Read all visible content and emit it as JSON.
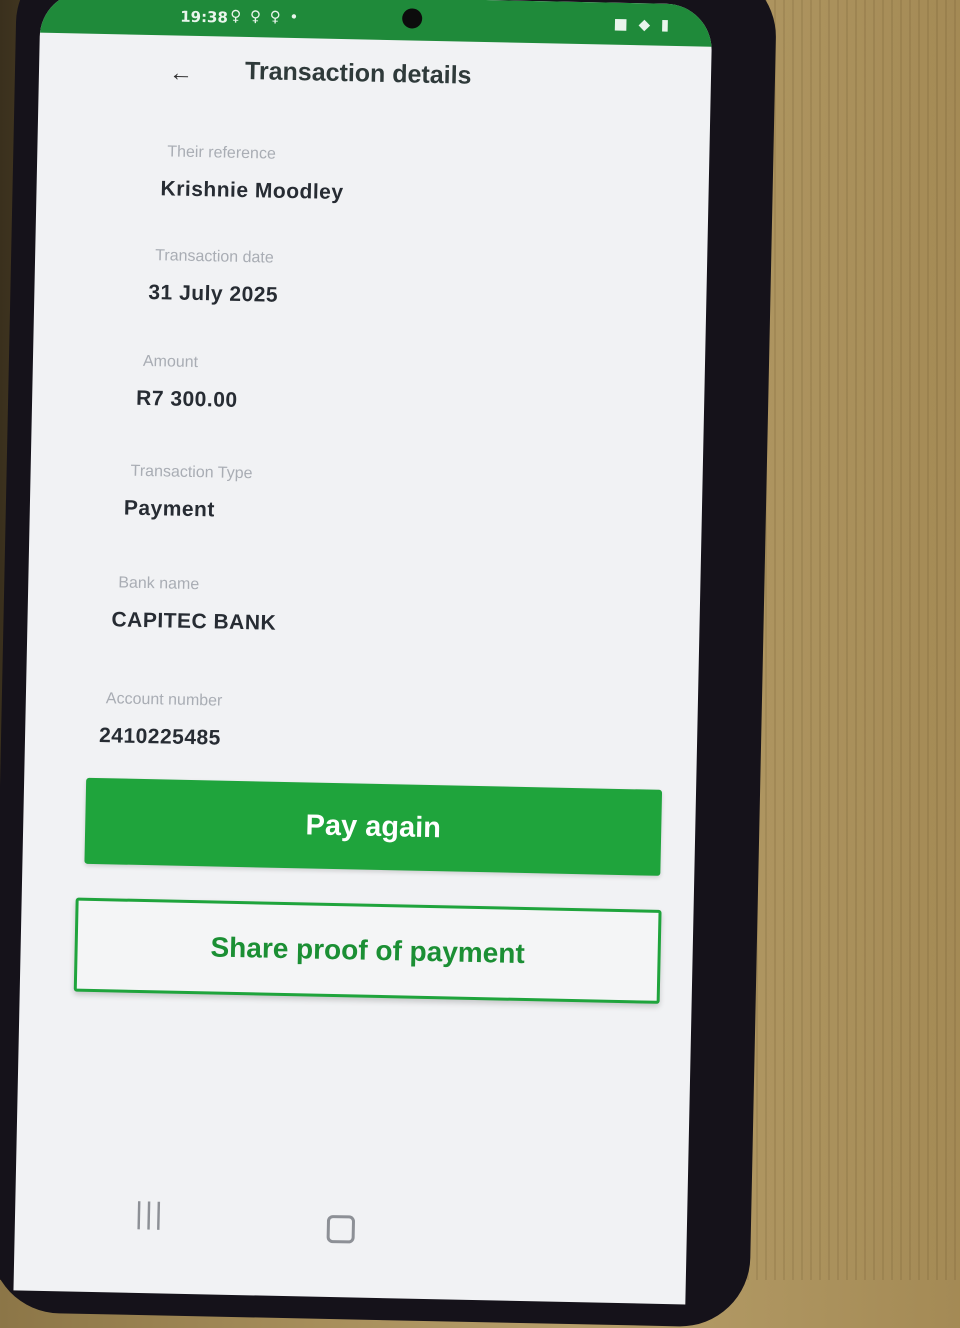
{
  "status_bar": {
    "time": "19:38",
    "notification_icons": "♀ ♀ ♀ •",
    "system_icons": "■ ◆ ▮"
  },
  "header": {
    "back_icon": "←",
    "title": "Transaction details"
  },
  "fields": [
    {
      "label": "Their reference",
      "value": "Krishnie Moodley"
    },
    {
      "label": "Transaction date",
      "value": "31 July 2025"
    },
    {
      "label": "Amount",
      "value": "R7 300.00"
    },
    {
      "label": "Transaction Type",
      "value": "Payment"
    },
    {
      "label": "Bank name",
      "value": "CAPITEC BANK"
    },
    {
      "label": "Account number",
      "value": "2410225485"
    }
  ],
  "actions": {
    "pay_again_label": "Pay again",
    "share_label": "Share proof of payment"
  },
  "nav": {
    "recent_icon": "|||"
  },
  "colors": {
    "brand_green": "#1fa43c",
    "status_bar": "#1f8a3a"
  }
}
